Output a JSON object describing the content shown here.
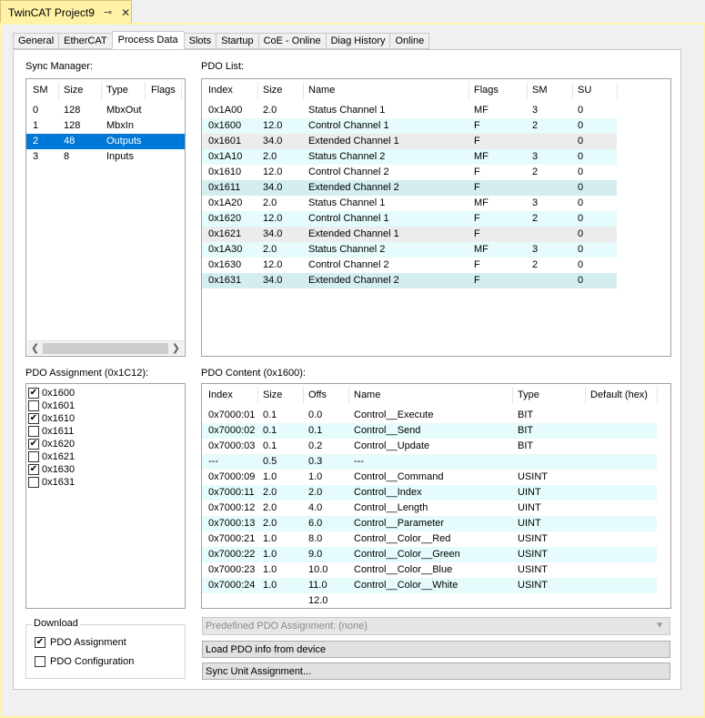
{
  "document_tab": {
    "title": "TwinCAT Project9",
    "pin_icon": "pin-icon",
    "close_icon": "close-icon"
  },
  "tabs": [
    "General",
    "EtherCAT",
    "Process Data",
    "Slots",
    "Startup",
    "CoE - Online",
    "Diag History",
    "Online"
  ],
  "active_tab": "Process Data",
  "sync_manager": {
    "label": "Sync Manager:",
    "headers": [
      "SM",
      "Size",
      "Type",
      "Flags"
    ],
    "rows": [
      [
        "0",
        "128",
        "MbxOut",
        ""
      ],
      [
        "1",
        "128",
        "MbxIn",
        ""
      ],
      [
        "2",
        "48",
        "Outputs",
        ""
      ],
      [
        "3",
        "8",
        "Inputs",
        ""
      ]
    ],
    "selected_row": 2
  },
  "pdo_list": {
    "label": "PDO List:",
    "headers": [
      "Index",
      "Size",
      "Name",
      "Flags",
      "SM",
      "SU"
    ],
    "rows": [
      [
        "0x1A00",
        "2.0",
        "Status Channel 1",
        "MF",
        "3",
        "0"
      ],
      [
        "0x1600",
        "12.0",
        "Control Channel 1",
        "F",
        "2",
        "0"
      ],
      [
        "0x1601",
        "34.0",
        "Extended Channel 1",
        "F",
        "",
        "0"
      ],
      [
        "0x1A10",
        "2.0",
        "Status Channel 2",
        "MF",
        "3",
        "0"
      ],
      [
        "0x1610",
        "12.0",
        "Control Channel 2",
        "F",
        "2",
        "0"
      ],
      [
        "0x1611",
        "34.0",
        "Extended Channel 2",
        "F",
        "",
        "0"
      ],
      [
        "0x1A20",
        "2.0",
        "Status Channel 1",
        "MF",
        "3",
        "0"
      ],
      [
        "0x1620",
        "12.0",
        "Control Channel 1",
        "F",
        "2",
        "0"
      ],
      [
        "0x1621",
        "34.0",
        "Extended Channel 1",
        "F",
        "",
        "0"
      ],
      [
        "0x1A30",
        "2.0",
        "Status Channel 2",
        "MF",
        "3",
        "0"
      ],
      [
        "0x1630",
        "12.0",
        "Control Channel 2",
        "F",
        "2",
        "0"
      ],
      [
        "0x1631",
        "34.0",
        "Extended Channel 2",
        "F",
        "",
        "0"
      ]
    ],
    "row_styles": [
      "",
      "cyan",
      "gray",
      "cyan",
      "",
      "teal",
      "",
      "cyan",
      "gray",
      "cyan",
      "",
      "teal"
    ]
  },
  "pdo_assignment": {
    "label": "PDO Assignment (0x1C12):",
    "items": [
      {
        "label": "0x1600",
        "checked": true
      },
      {
        "label": "0x1601",
        "checked": false
      },
      {
        "label": "0x1610",
        "checked": true
      },
      {
        "label": "0x1611",
        "checked": false
      },
      {
        "label": "0x1620",
        "checked": true
      },
      {
        "label": "0x1621",
        "checked": false
      },
      {
        "label": "0x1630",
        "checked": true
      },
      {
        "label": "0x1631",
        "checked": false
      }
    ]
  },
  "pdo_content": {
    "label": "PDO Content (0x1600):",
    "headers": [
      "Index",
      "Size",
      "Offs",
      "Name",
      "Type",
      "Default (hex)"
    ],
    "rows": [
      [
        "0x7000:01",
        "0.1",
        "0.0",
        "Control__Execute",
        "BIT",
        ""
      ],
      [
        "0x7000:02",
        "0.1",
        "0.1",
        "Control__Send",
        "BIT",
        ""
      ],
      [
        "0x7000:03",
        "0.1",
        "0.2",
        "Control__Update",
        "BIT",
        ""
      ],
      [
        "---",
        "0.5",
        "0.3",
        "---",
        "",
        ""
      ],
      [
        "0x7000:09",
        "1.0",
        "1.0",
        "Control__Command",
        "USINT",
        ""
      ],
      [
        "0x7000:11",
        "2.0",
        "2.0",
        "Control__Index",
        "UINT",
        ""
      ],
      [
        "0x7000:12",
        "2.0",
        "4.0",
        "Control__Length",
        "UINT",
        ""
      ],
      [
        "0x7000:13",
        "2.0",
        "6.0",
        "Control__Parameter",
        "UINT",
        ""
      ],
      [
        "0x7000:21",
        "1.0",
        "8.0",
        "Control__Color__Red",
        "USINT",
        ""
      ],
      [
        "0x7000:22",
        "1.0",
        "9.0",
        "Control__Color__Green",
        "USINT",
        ""
      ],
      [
        "0x7000:23",
        "1.0",
        "10.0",
        "Control__Color__Blue",
        "USINT",
        ""
      ],
      [
        "0x7000:24",
        "1.0",
        "11.0",
        "Control__Color__White",
        "USINT",
        ""
      ],
      [
        "",
        "",
        "12.0",
        "",
        "",
        ""
      ]
    ],
    "row_styles": [
      "",
      "cyan",
      "",
      "cyan",
      "",
      "cyan",
      "",
      "cyan",
      "",
      "cyan",
      "",
      "cyan",
      ""
    ]
  },
  "download": {
    "legend": "Download",
    "items": [
      {
        "label": "PDO Assignment",
        "checked": true
      },
      {
        "label": "PDO Configuration",
        "checked": false
      }
    ]
  },
  "predefined_combo": {
    "value": "Predefined PDO Assignment: (none)"
  },
  "buttons": {
    "load": "Load PDO info from device",
    "sync_unit": "Sync Unit Assignment..."
  },
  "colors": {
    "selection": "#0078d7",
    "row_cyan": "#e5fbfc",
    "row_teal": "#d4eef0",
    "row_gray": "#ececec",
    "document_tab": "#fff2a6"
  }
}
